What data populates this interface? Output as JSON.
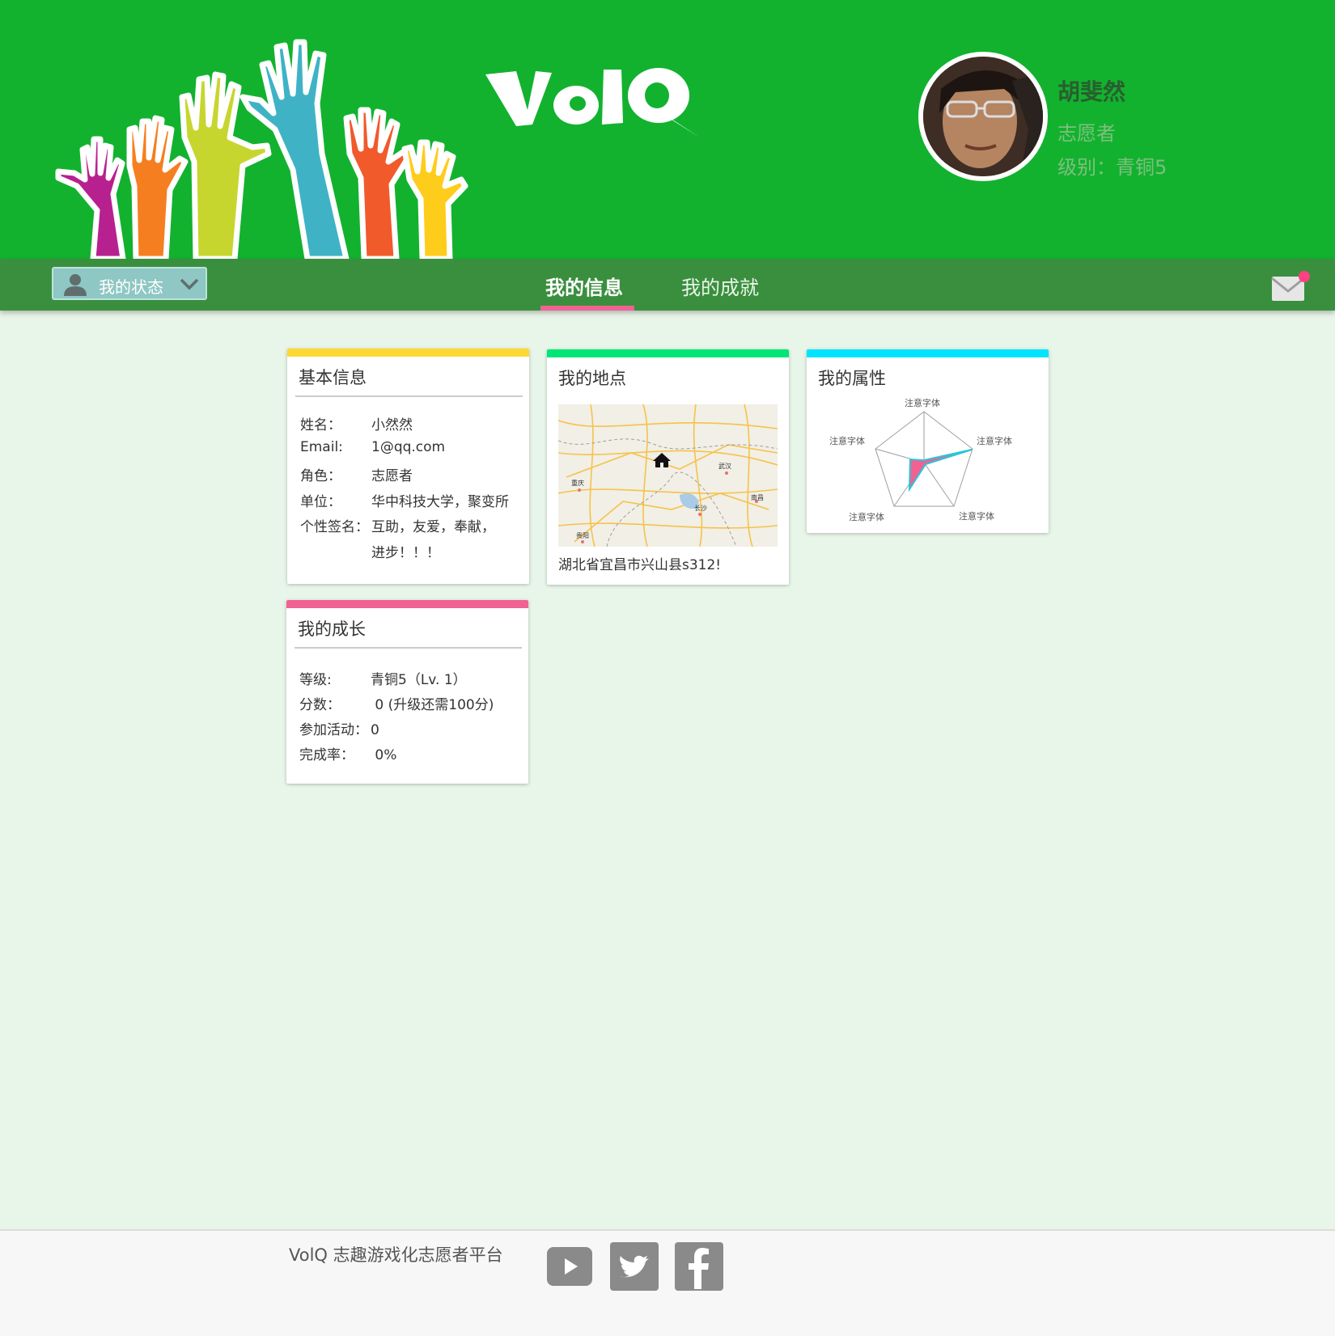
{
  "app": {
    "logo_text": "VolQ"
  },
  "user": {
    "name": "胡斐然",
    "role": "志愿者",
    "level": "级别：青铜5"
  },
  "nav": {
    "status_label": "我的状态",
    "tabs": [
      {
        "label": "我的信息",
        "active": true
      },
      {
        "label": "我的成就",
        "active": false
      }
    ]
  },
  "cards": {
    "basic": {
      "title": "基本信息",
      "rows": [
        {
          "key": "姓名：",
          "value": "小然然"
        },
        {
          "key": "Email:",
          "value": "1@qq.com"
        },
        {
          "key": "角色：",
          "value": "志愿者"
        },
        {
          "key": "单位：",
          "value": "华中科技大学，聚变所"
        },
        {
          "key": "个性签名：",
          "value": "互助，友爱，奉献，"
        },
        {
          "key": "",
          "value": "进步！！！"
        }
      ]
    },
    "location": {
      "title": "我的地点",
      "address": "湖北省宜昌市兴山县s312!",
      "map_labels": [
        "武汉",
        "重庆",
        "长沙",
        "南昌",
        "贵阳"
      ]
    },
    "attributes": {
      "title": "我的属性",
      "axis_label": "注意字体"
    },
    "growth": {
      "title": "我的成长",
      "rows": [
        {
          "key": "等级:",
          "value": "青铜5（Lv. 1）"
        },
        {
          "key": "分数：",
          "value": " 0 (升级还需100分)"
        },
        {
          "key": "参加活动：",
          "value": "0"
        },
        {
          "key": "完成率：",
          "value": "  0%"
        }
      ]
    }
  },
  "footer": {
    "text": "VolQ 志趣游戏化志愿者平台"
  },
  "colors": {
    "header": "#12b22f",
    "nav": "#3a8f3e",
    "tab_indicator": "#f06292",
    "basic_bar": "#fdd835",
    "location_bar": "#00e676",
    "attributes_bar": "#00e5ff",
    "growth_bar": "#f06292"
  }
}
